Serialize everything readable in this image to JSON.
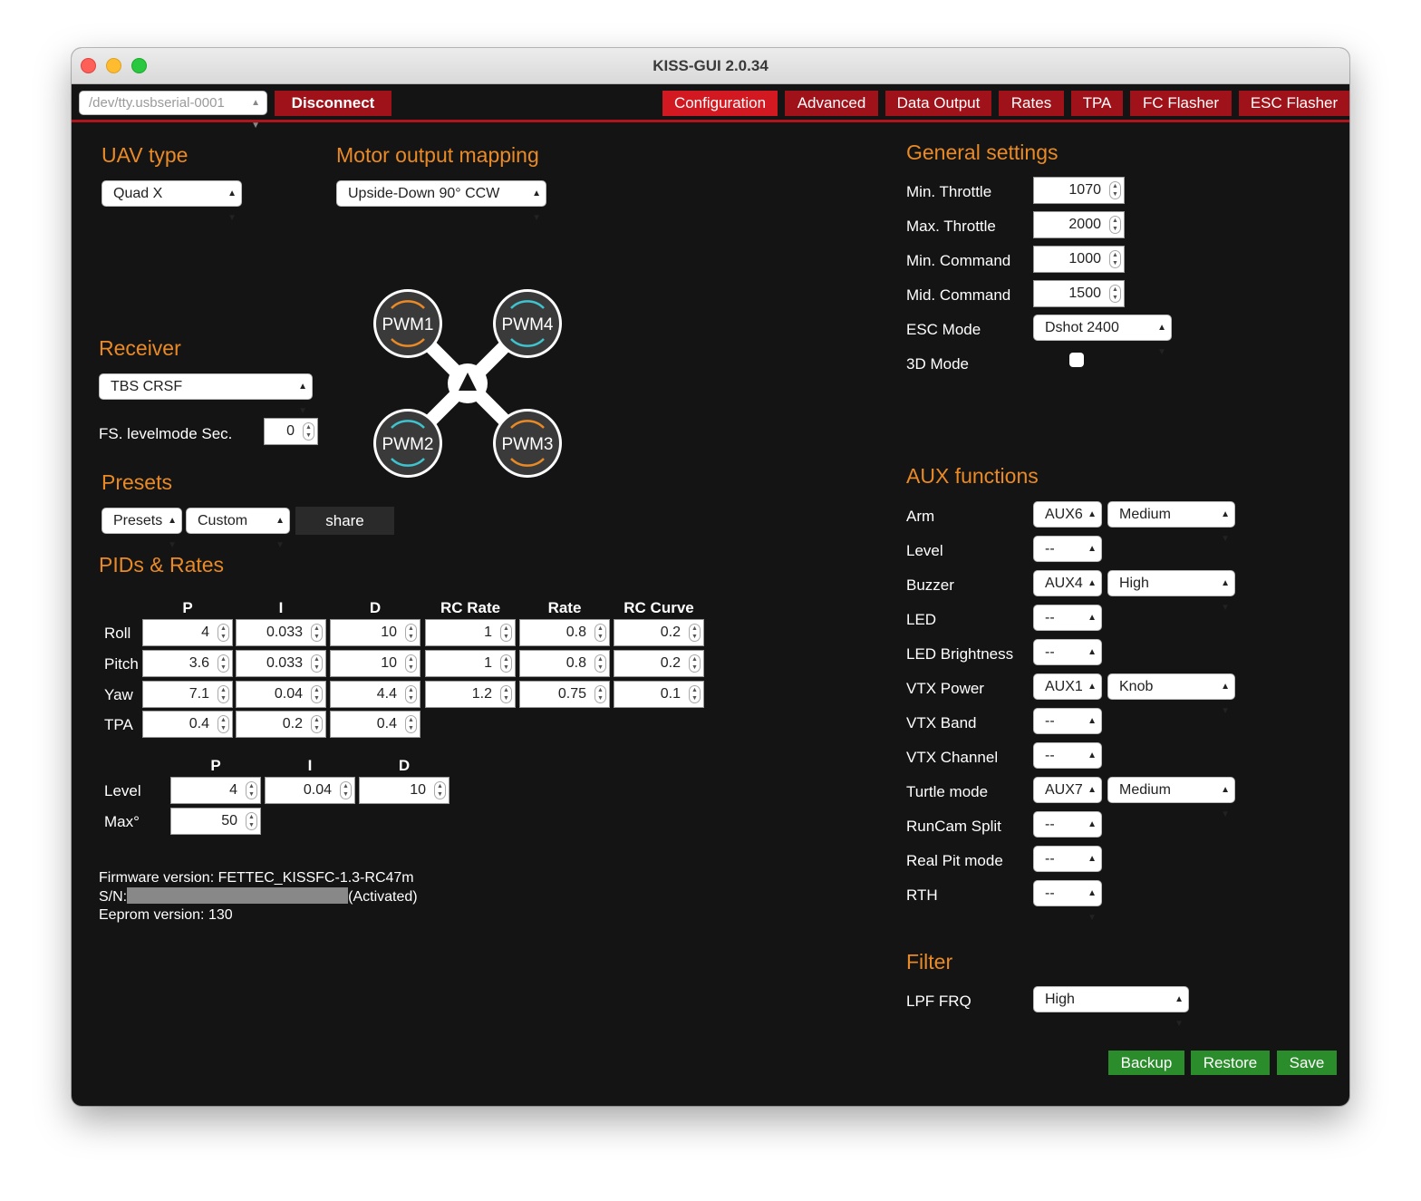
{
  "window": {
    "title": "KISS-GUI 2.0.34"
  },
  "toolbar": {
    "port": "/dev/tty.usbserial-0001",
    "disconnect": "Disconnect",
    "tabs": [
      "Configuration",
      "Advanced",
      "Data Output",
      "Rates",
      "TPA",
      "FC Flasher",
      "ESC Flasher"
    ],
    "active_tab": "Configuration"
  },
  "uav": {
    "heading": "UAV type",
    "value": "Quad X"
  },
  "motor": {
    "heading": "Motor output mapping",
    "value": "Upside-Down 90° CCW",
    "motors": [
      "PWM1",
      "PWM4",
      "PWM2",
      "PWM3"
    ]
  },
  "receiver": {
    "heading": "Receiver",
    "value": "TBS CRSF",
    "fs_label": "FS. levelmode Sec.",
    "fs_value": "0"
  },
  "presets": {
    "heading": "Presets",
    "presets_value": "Presets",
    "custom_value": "Custom",
    "share": "share"
  },
  "pids": {
    "heading": "PIDs & Rates",
    "columns": [
      "P",
      "I",
      "D",
      "RC Rate",
      "Rate",
      "RC Curve"
    ],
    "rows": [
      {
        "label": "Roll",
        "values": [
          "4",
          "0.033",
          "10",
          "1",
          "0.8",
          "0.2"
        ]
      },
      {
        "label": "Pitch",
        "values": [
          "3.6",
          "0.033",
          "10",
          "1",
          "0.8",
          "0.2"
        ]
      },
      {
        "label": "Yaw",
        "values": [
          "7.1",
          "0.04",
          "4.4",
          "1.2",
          "0.75",
          "0.1"
        ]
      },
      {
        "label": "TPA",
        "values": [
          "0.4",
          "0.2",
          "0.4"
        ]
      }
    ],
    "level_columns": [
      "P",
      "I",
      "D"
    ],
    "level": {
      "label": "Level",
      "values": [
        "4",
        "0.04",
        "10"
      ]
    },
    "maxdeg": {
      "label": "Max°",
      "value": "50"
    }
  },
  "firmware": {
    "version": "Firmware version: FETTEC_KISSFC-1.3-RC47m",
    "sn_label": "S/N:",
    "sn_status": "(Activated)",
    "eeprom": "Eeprom version: 130"
  },
  "general": {
    "heading": "General settings",
    "min_throttle": {
      "label": "Min. Throttle",
      "value": "1070"
    },
    "max_throttle": {
      "label": "Max. Throttle",
      "value": "2000"
    },
    "min_command": {
      "label": "Min. Command",
      "value": "1000"
    },
    "mid_command": {
      "label": "Mid. Command",
      "value": "1500"
    },
    "esc_mode": {
      "label": "ESC Mode",
      "value": "Dshot 2400"
    },
    "mode_3d": {
      "label": "3D Mode",
      "checked": false
    }
  },
  "aux": {
    "heading": "AUX functions",
    "items": [
      {
        "label": "Arm",
        "channel": "AUX6",
        "mode": "Medium"
      },
      {
        "label": "Level",
        "channel": "--",
        "mode": ""
      },
      {
        "label": "Buzzer",
        "channel": "AUX4",
        "mode": "High"
      },
      {
        "label": "LED",
        "channel": "--",
        "mode": ""
      },
      {
        "label": "LED Brightness",
        "channel": "--",
        "mode": ""
      },
      {
        "label": "VTX Power",
        "channel": "AUX1",
        "mode": "Knob"
      },
      {
        "label": "VTX Band",
        "channel": "--",
        "mode": ""
      },
      {
        "label": "VTX Channel",
        "channel": "--",
        "mode": ""
      },
      {
        "label": "Turtle mode",
        "channel": "AUX7",
        "mode": "Medium"
      },
      {
        "label": "RunCam Split",
        "channel": "--",
        "mode": ""
      },
      {
        "label": "Real Pit mode",
        "channel": "--",
        "mode": ""
      },
      {
        "label": "RTH",
        "channel": "--",
        "mode": ""
      }
    ]
  },
  "filter": {
    "heading": "Filter",
    "lpf_label": "LPF FRQ",
    "lpf_value": "High"
  },
  "actions": {
    "backup": "Backup",
    "restore": "Restore",
    "save": "Save"
  },
  "colors": {
    "accent": "#e98a26",
    "tab_active": "#d21820",
    "tab": "#a01219",
    "action": "#2b8c2b",
    "background": "#141414"
  }
}
